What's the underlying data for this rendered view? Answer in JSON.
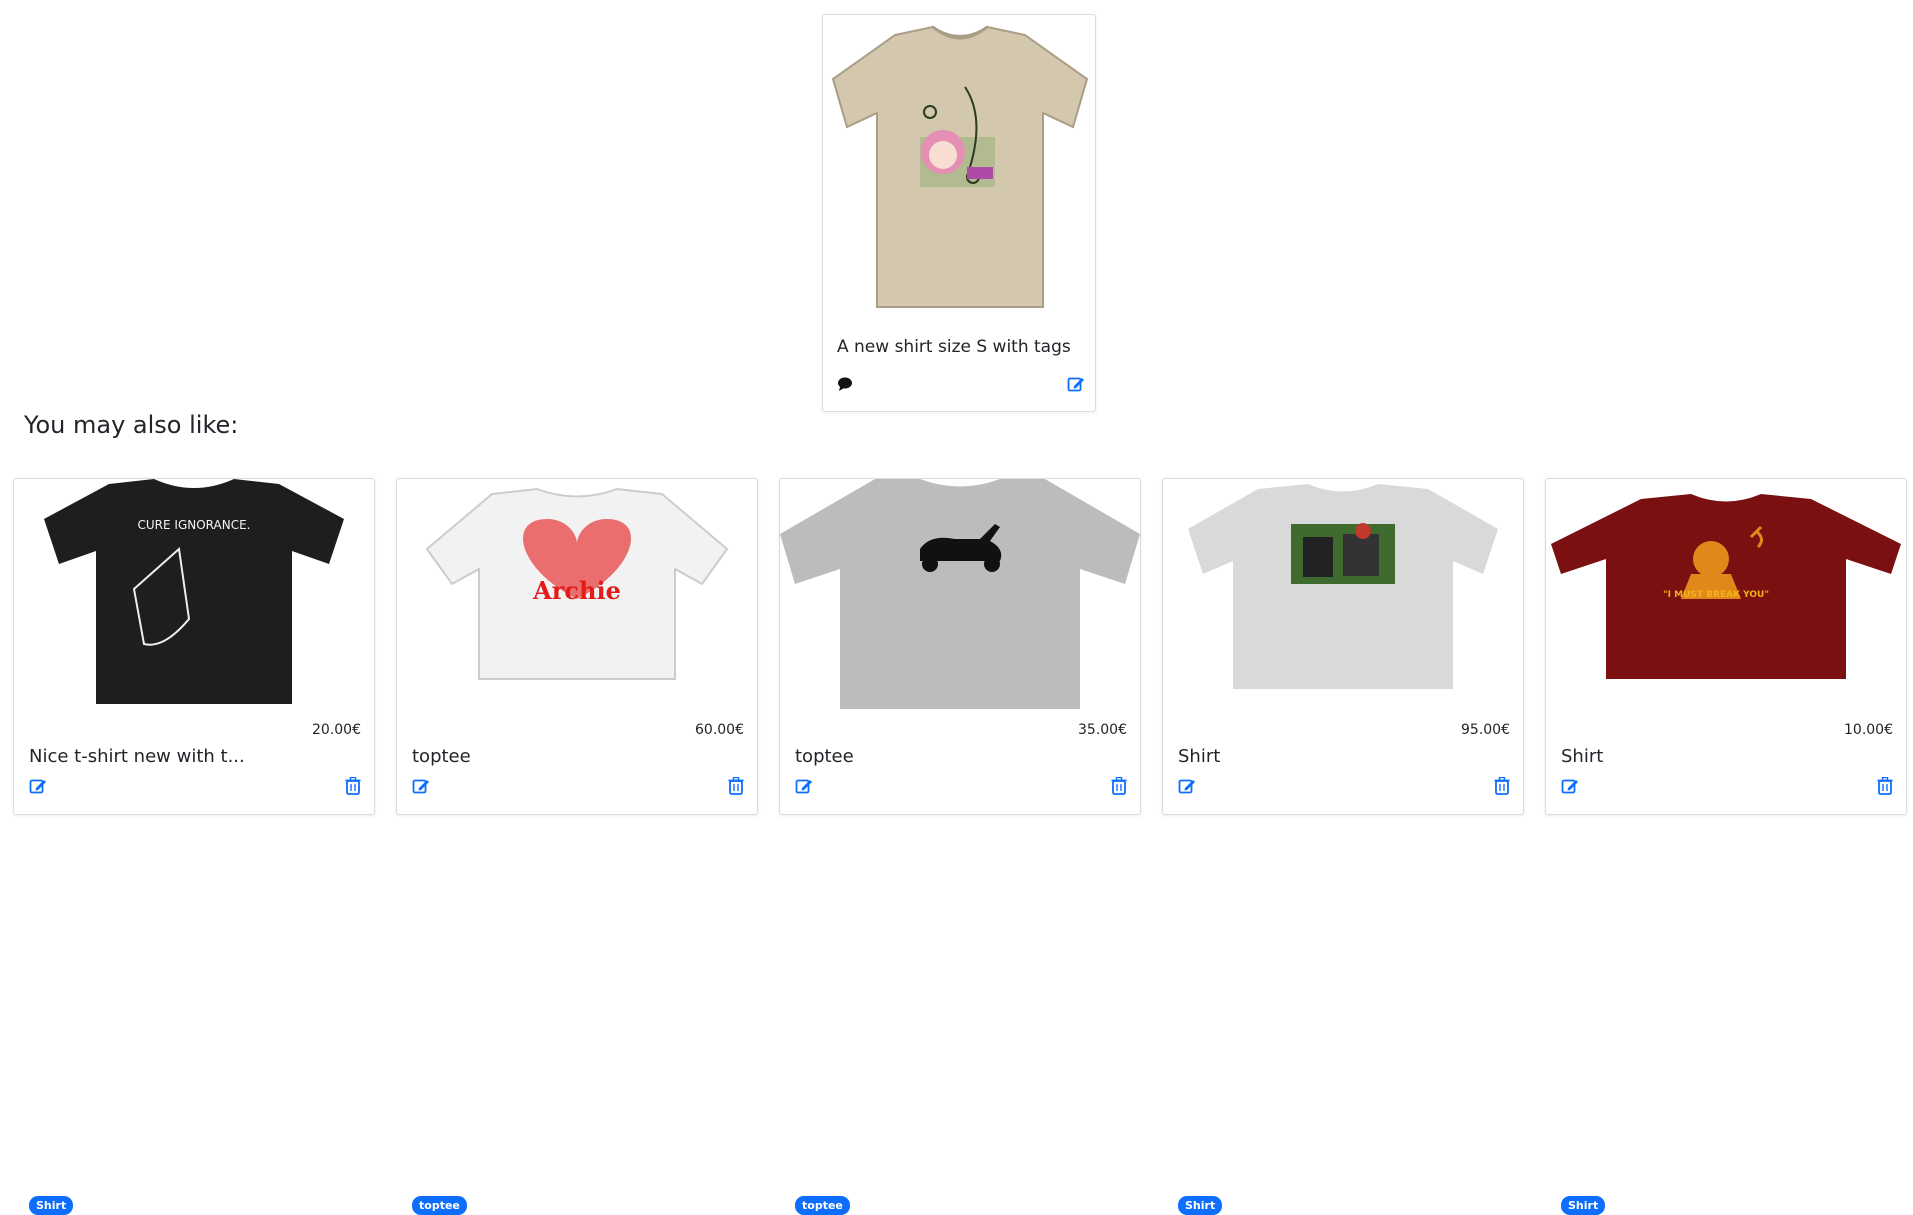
{
  "main_product": {
    "title": "A new shirt size S with tags",
    "shirt_color": "#d3c7ae",
    "icons": {
      "comment": "comment-icon",
      "edit": "edit-icon"
    }
  },
  "recommendations": {
    "heading": "You may also like:",
    "items": [
      {
        "badge": "Shirt",
        "price": "20.00€",
        "title": "Nice t-shirt new with t...",
        "shirt_color": "#1f1d1d",
        "print_text": "CURE IGNORANCE."
      },
      {
        "badge": "toptee",
        "price": "60.00€",
        "title": "toptee",
        "shirt_color": "#f2f2f2",
        "print_text": "Archie"
      },
      {
        "badge": "toptee",
        "price": "35.00€",
        "title": "toptee",
        "shirt_color": "#bcbcbf",
        "print_text": ""
      },
      {
        "badge": "Shirt",
        "price": "95.00€",
        "title": "Shirt",
        "shirt_color": "#d9d9d9",
        "print_text": ""
      },
      {
        "badge": "Shirt",
        "price": "10.00€",
        "title": "Shirt",
        "shirt_color": "#7a1010",
        "print_text": "\"I MUST BREAK YOU\""
      }
    ]
  },
  "colors": {
    "accent": "#0d6efd"
  }
}
